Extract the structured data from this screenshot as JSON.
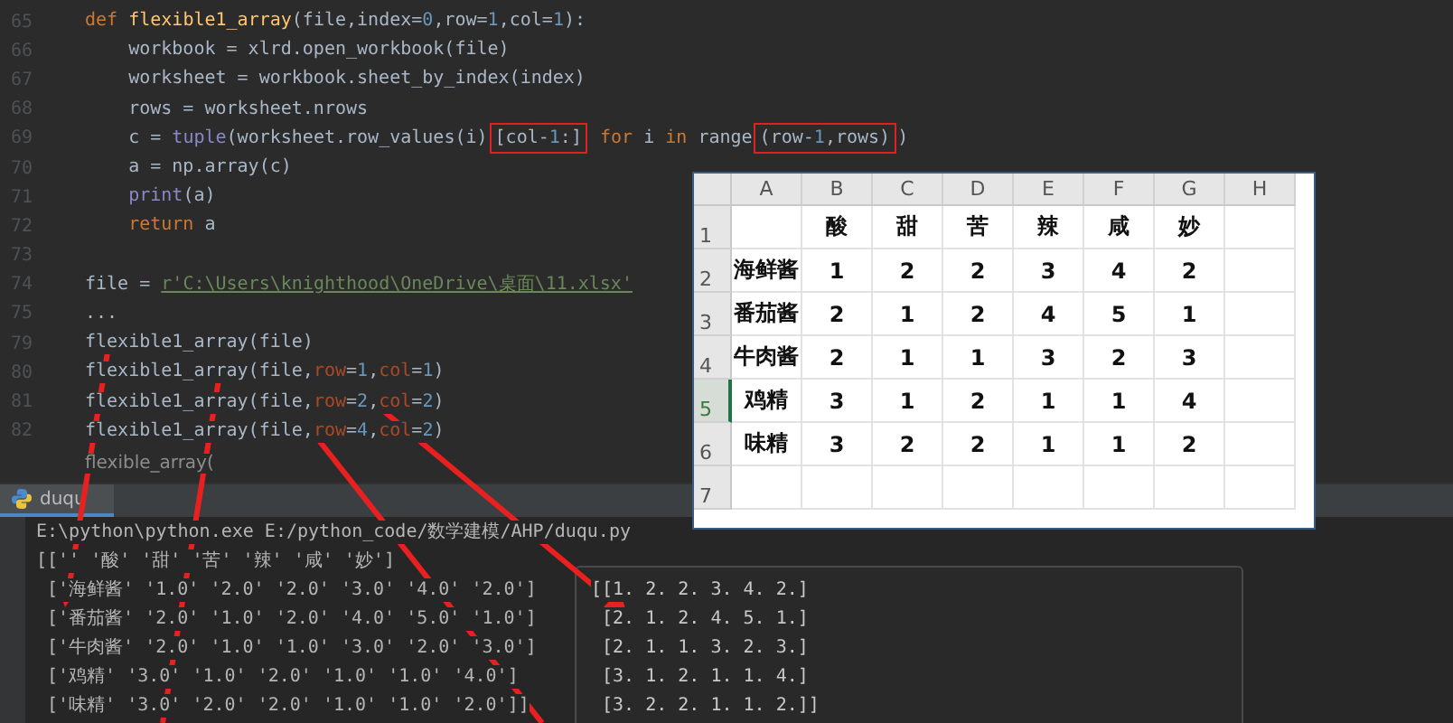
{
  "editor": {
    "lines": [
      {
        "number": "65",
        "tokens": [
          {
            "kind": "kw",
            "text": "def "
          },
          {
            "kind": "fn",
            "text": "flexible1_array"
          },
          {
            "kind": "plain",
            "text": "(file,index="
          },
          {
            "kind": "num",
            "text": "0"
          },
          {
            "kind": "plain",
            "text": ",row="
          },
          {
            "kind": "num",
            "text": "1"
          },
          {
            "kind": "plain",
            "text": ",col="
          },
          {
            "kind": "num",
            "text": "1"
          },
          {
            "kind": "plain",
            "text": "):"
          }
        ]
      },
      {
        "number": "66",
        "tokens": [
          {
            "kind": "plain",
            "text": "    workbook = xlrd.open_workbook(file)"
          }
        ]
      },
      {
        "number": "67",
        "tokens": [
          {
            "kind": "plain",
            "text": "    worksheet = workbook.sheet_by_index(index)"
          }
        ]
      },
      {
        "number": "68",
        "tokens": [
          {
            "kind": "plain",
            "text": "    rows = worksheet.nrows"
          }
        ]
      },
      {
        "number": "69",
        "tokens": [
          {
            "kind": "plain",
            "text": "    c = "
          },
          {
            "kind": "builtin",
            "text": "tuple"
          },
          {
            "kind": "plain",
            "text": "(worksheet.row_values(i)"
          },
          {
            "kind": "boxed",
            "tokens": [
              {
                "kind": "plain",
                "text": "[col-"
              },
              {
                "kind": "num",
                "text": "1"
              },
              {
                "kind": "plain",
                "text": ":]"
              }
            ]
          },
          {
            "kind": "kw",
            "text": " for "
          },
          {
            "kind": "plain",
            "text": "i "
          },
          {
            "kind": "kw",
            "text": "in "
          },
          {
            "kind": "plain",
            "text": "range"
          },
          {
            "kind": "boxed",
            "tokens": [
              {
                "kind": "plain",
                "text": "(row-"
              },
              {
                "kind": "num",
                "text": "1"
              },
              {
                "kind": "plain",
                "text": ",rows)"
              }
            ]
          },
          {
            "kind": "plain",
            "text": ")"
          }
        ]
      },
      {
        "number": "70",
        "tokens": [
          {
            "kind": "plain",
            "text": "    a = np.array(c)"
          }
        ]
      },
      {
        "number": "71",
        "tokens": [
          {
            "kind": "builtin",
            "text": "    print"
          },
          {
            "kind": "plain",
            "text": "(a)"
          }
        ]
      },
      {
        "number": "72",
        "tokens": [
          {
            "kind": "kw",
            "text": "    return "
          },
          {
            "kind": "plain",
            "text": "a"
          }
        ]
      },
      {
        "number": "73"
      },
      {
        "number": "74",
        "tokens": [
          {
            "kind": "plain",
            "text": "file = "
          },
          {
            "kind": "str",
            "text": "r'C:\\Users\\knighthood\\OneDrive\\桌面\\11.xlsx'"
          }
        ]
      },
      {
        "number": "75",
        "tokens": [
          {
            "kind": "plain",
            "text": "..."
          }
        ]
      },
      {
        "number": "79",
        "tokens": [
          {
            "kind": "plain",
            "text": "flexible1_array(file)"
          }
        ]
      },
      {
        "number": "80",
        "tokens": [
          {
            "kind": "plain",
            "text": "flexible1_array(file,"
          },
          {
            "kind": "param",
            "text": "row"
          },
          {
            "kind": "plain",
            "text": "="
          },
          {
            "kind": "num",
            "text": "1"
          },
          {
            "kind": "plain",
            "text": ","
          },
          {
            "kind": "param",
            "text": "col"
          },
          {
            "kind": "plain",
            "text": "="
          },
          {
            "kind": "num",
            "text": "1"
          },
          {
            "kind": "plain",
            "text": ")"
          }
        ]
      },
      {
        "number": "81",
        "tokens": [
          {
            "kind": "plain",
            "text": "flexible1_array(file,"
          },
          {
            "kind": "param",
            "text": "row"
          },
          {
            "kind": "plain",
            "text": "="
          },
          {
            "kind": "num",
            "text": "2"
          },
          {
            "kind": "plain",
            "text": ","
          },
          {
            "kind": "param",
            "text": "col"
          },
          {
            "kind": "plain",
            "text": "="
          },
          {
            "kind": "num",
            "text": "2"
          },
          {
            "kind": "plain",
            "text": ")"
          }
        ]
      },
      {
        "number": "82",
        "tokens": [
          {
            "kind": "plain",
            "text": "flexible1_array(file,"
          },
          {
            "kind": "param",
            "text": "row"
          },
          {
            "kind": "plain",
            "text": "="
          },
          {
            "kind": "num",
            "text": "4"
          },
          {
            "kind": "plain",
            "text": ","
          },
          {
            "kind": "param",
            "text": "col"
          },
          {
            "kind": "plain",
            "text": "="
          },
          {
            "kind": "num",
            "text": "2"
          },
          {
            "kind": "plain",
            "text": ")"
          }
        ]
      }
    ],
    "hint": "flexible_array("
  },
  "run_tab": {
    "label": "duqu"
  },
  "console": {
    "lines": [
      "E:\\python\\python.exe E:/python_code/数学建模/AHP/duqu.py",
      "[['' '酸' '甜' '苦' '辣' '咸' '妙']",
      " ['海鲜酱' '1.0' '2.0' '2.0' '3.0' '4.0' '2.0']",
      " ['番茄酱' '2.0' '1.0' '2.0' '4.0' '5.0' '1.0']",
      " ['牛肉酱' '2.0' '1.0' '1.0' '3.0' '2.0' '3.0']",
      " ['鸡精' '3.0' '1.0' '2.0' '1.0' '1.0' '4.0']",
      " ['味精' '3.0' '2.0' '2.0' '1.0' '1.0' '2.0']]"
    ]
  },
  "output_panel": {
    "lines": [
      "[[1. 2. 2. 3. 4. 2.]",
      " [2. 1. 2. 4. 5. 1.]",
      " [2. 1. 1. 3. 2. 3.]",
      " [3. 1. 2. 1. 1. 4.]",
      " [3. 2. 2. 1. 1. 2.]]"
    ]
  },
  "spreadsheet": {
    "columns": [
      "A",
      "B",
      "C",
      "D",
      "E",
      "F",
      "G",
      "H"
    ],
    "rows": [
      {
        "header": "1",
        "selected": false,
        "cells": [
          null,
          "酸",
          "甜",
          "苦",
          "辣",
          "咸",
          "妙"
        ]
      },
      {
        "header": "2",
        "selected": false,
        "cells": [
          "海鲜酱",
          "1",
          "2",
          "2",
          "3",
          "4",
          "2"
        ]
      },
      {
        "header": "3",
        "selected": false,
        "cells": [
          "番茄酱",
          "2",
          "1",
          "2",
          "4",
          "5",
          "1"
        ]
      },
      {
        "header": "4",
        "selected": false,
        "cells": [
          "牛肉酱",
          "2",
          "1",
          "1",
          "3",
          "2",
          "3"
        ]
      },
      {
        "header": "5",
        "selected": true,
        "cells": [
          "鸡精",
          "3",
          "1",
          "2",
          "1",
          "1",
          "4"
        ]
      },
      {
        "header": "6",
        "selected": false,
        "cells": [
          "味精",
          "3",
          "2",
          "2",
          "1",
          "1",
          "2"
        ]
      },
      {
        "header": "7",
        "selected": false
      }
    ]
  }
}
